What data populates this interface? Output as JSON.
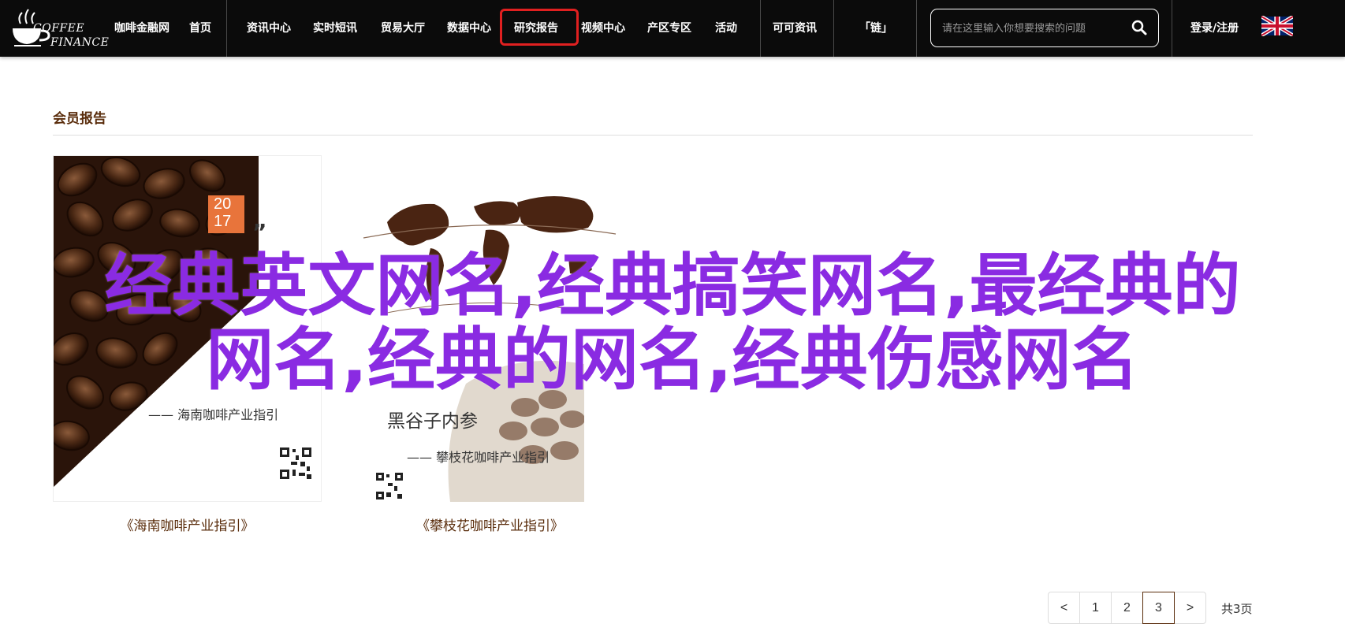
{
  "header": {
    "logo_line1": "COFFEE",
    "logo_line2": "FINANCE",
    "nav": [
      {
        "label": "咖啡金融网"
      },
      {
        "label": "首页"
      },
      {
        "label": "资讯中心"
      },
      {
        "label": "实时短讯"
      },
      {
        "label": "贸易大厅"
      },
      {
        "label": "数据中心"
      },
      {
        "label": "研究报告",
        "highlighted": true
      },
      {
        "label": "视频中心"
      },
      {
        "label": "产区专区"
      },
      {
        "label": "活动"
      },
      {
        "label": "可可资讯"
      },
      {
        "label": "「链」"
      }
    ],
    "search": {
      "placeholder": "请在这里输入你想要搜索的问题"
    },
    "login_label": "登录/注册",
    "flag_icon": "uk-flag-icon",
    "highlight_color": "#e02020"
  },
  "section": {
    "title": "会员报告"
  },
  "cards": [
    {
      "caption": "《海南咖啡产业指引》",
      "cover": {
        "year_top": "20",
        "year_bottom": "17",
        "quote_mark": "”",
        "subtitle": "—— 海南咖啡产业指引"
      }
    },
    {
      "caption": "《攀枝花咖啡产业指引》",
      "cover": {
        "title": "黑谷子内参",
        "subtitle": "—— 攀枝花咖啡产业指引"
      }
    }
  ],
  "overlay": {
    "line1": "经典英文网名,经典搞笑网名,最经典的",
    "line2": "网名,经典的网名,经典伤感网名",
    "color": "#8a2be2"
  },
  "pagination": {
    "prev": "<",
    "pages": [
      "1",
      "2",
      "3"
    ],
    "current": "3",
    "next": ">",
    "total_label": "共3页"
  },
  "colors": {
    "nav_bg": "#0b0b0b",
    "brand_brown": "#5a2d0c",
    "cover_orange": "#e8743b"
  }
}
